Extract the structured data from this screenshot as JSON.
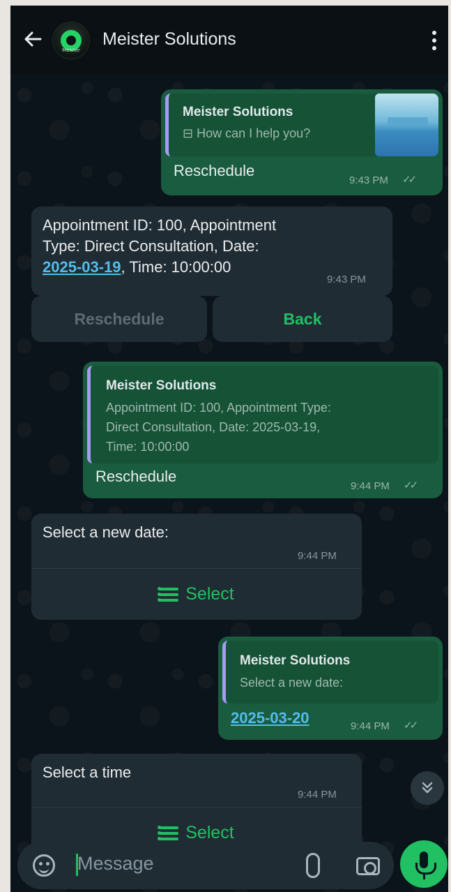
{
  "header": {
    "title": "Meister Solutions",
    "avatar_text": "Meister"
  },
  "messages": [
    {
      "quote_title": "Meister Solutions",
      "quote_body": "⊟ How can I help you?",
      "text": "Reschedule",
      "time": "9:43 PM"
    },
    {
      "text_line1": "Appointment ID: 100, Appointment",
      "text_line2": "Type: Direct Consultation, Date:",
      "text_link": "2025-03-19",
      "text_line3_rest": ", Time: 10:00:00",
      "time": "9:43 PM",
      "buttons": [
        "Reschedule",
        "Back"
      ]
    },
    {
      "quote_title": "Meister Solutions",
      "quote_line1": "Appointment ID: 100, Appointment Type:",
      "quote_line2": "Direct Consultation, Date: 2025-03-19,",
      "quote_line3": "Time: 10:00:00",
      "text": "Reschedule",
      "time": "9:44 PM"
    },
    {
      "text": "Select a new date:",
      "time": "9:44 PM",
      "button": "Select"
    },
    {
      "quote_title": "Meister Solutions",
      "quote_body": "Select a new date:",
      "text": "2025-03-20",
      "time": "9:44 PM"
    },
    {
      "text": "Select a time",
      "time": "9:44 PM",
      "button": "Select"
    }
  ],
  "input": {
    "placeholder": "Message"
  },
  "colors": {
    "accent": "#21c063",
    "outgoing_bubble": "#1a5c3f",
    "incoming_bubble": "#202c33",
    "link": "#53bdeb"
  },
  "icons": [
    "back-arrow-icon",
    "more-vert-icon",
    "emoji-sticker-icon",
    "attach-icon",
    "camera-icon",
    "mic-icon",
    "double-check-icon",
    "list-icon",
    "scroll-down-icon"
  ]
}
